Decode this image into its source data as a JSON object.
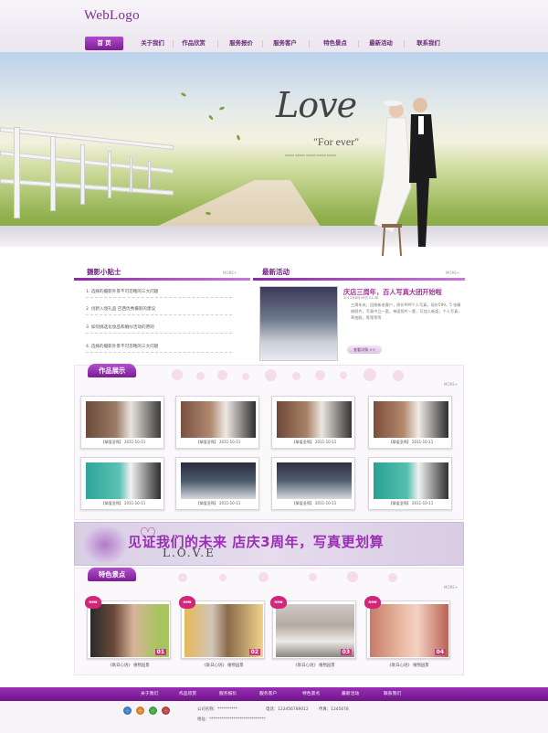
{
  "header": {
    "logo": "WebLogo",
    "nav": [
      "首 页",
      "关于我们",
      "作品欣赏",
      "服务报价",
      "服务客户",
      "特色景点",
      "最新活动",
      "联系我们"
    ]
  },
  "hero": {
    "love": "Love",
    "forever": "\"For ever\"",
    "small_text": "xxxxx xxxxx xxxxx xxxxx xxxxx"
  },
  "tips": {
    "title": "摄影小贴士",
    "more": "MORE+",
    "items": [
      "1. 选择的摄影外景不可忽略的三大问题",
      "2. 创新入境礼品 巴西优秀摄影的建议",
      "3. 如何挑选化妆品和婚纱活动的原则",
      "4. 选择的摄影外景不可忽略的三大问题"
    ]
  },
  "news": {
    "title": "最新活动",
    "more": "MORE+",
    "headline": "庆店三周年，百人写真大团开始啦",
    "date": "2011年8月09日 01:36",
    "desc": "三周年庆，回馈新老客户，原价999个人写真，现价599，5 张精修照片，写真中立一套，单面照片一套，可加入新类，个人写真，草拍照，等等等等",
    "button": "查看详情 >>"
  },
  "works": {
    "title": "作品展示",
    "more": "MORE+",
    "items": [
      "【挚爱圣殇】 2011-10-11",
      "【挚爱圣殇】 2011-10-11",
      "【挚爱圣殇】 2011-10-11",
      "【挚爱圣殇】 2011-10-11",
      "【挚爱圣殇】 2011-10-11",
      "【挚爱圣殇】 2011-10-11",
      "【挚爱圣殇】 2011-10-11",
      "【挚爱圣殇】 2011-10-11"
    ]
  },
  "banner": {
    "text": "见证我们的未来   店庆3周年，写真更划算",
    "love": "L.O.V.E"
  },
  "features": {
    "title": "特色景点",
    "more": "MORE+",
    "badge": "new",
    "items": [
      {
        "caption": "《耿日心语》 植物园景",
        "num": "01"
      },
      {
        "caption": "《耿日心语》 植物园景",
        "num": "02"
      },
      {
        "caption": "《耿日心语》 植物园景",
        "num": "03"
      },
      {
        "caption": "《耿日心语》 植物园景",
        "num": "04"
      }
    ]
  },
  "footer": {
    "nav": [
      "关于我们",
      "作品欣赏",
      "服务报价",
      "服务客户",
      "特色景点",
      "最新活动",
      "联系我们"
    ],
    "company": "公司名称：**********",
    "phone": "电话：123456789012",
    "fax": "传真：1245678",
    "address": "地址：****************************"
  },
  "colors": {
    "brand": "#7a1d93",
    "accent": "#a2349c"
  }
}
